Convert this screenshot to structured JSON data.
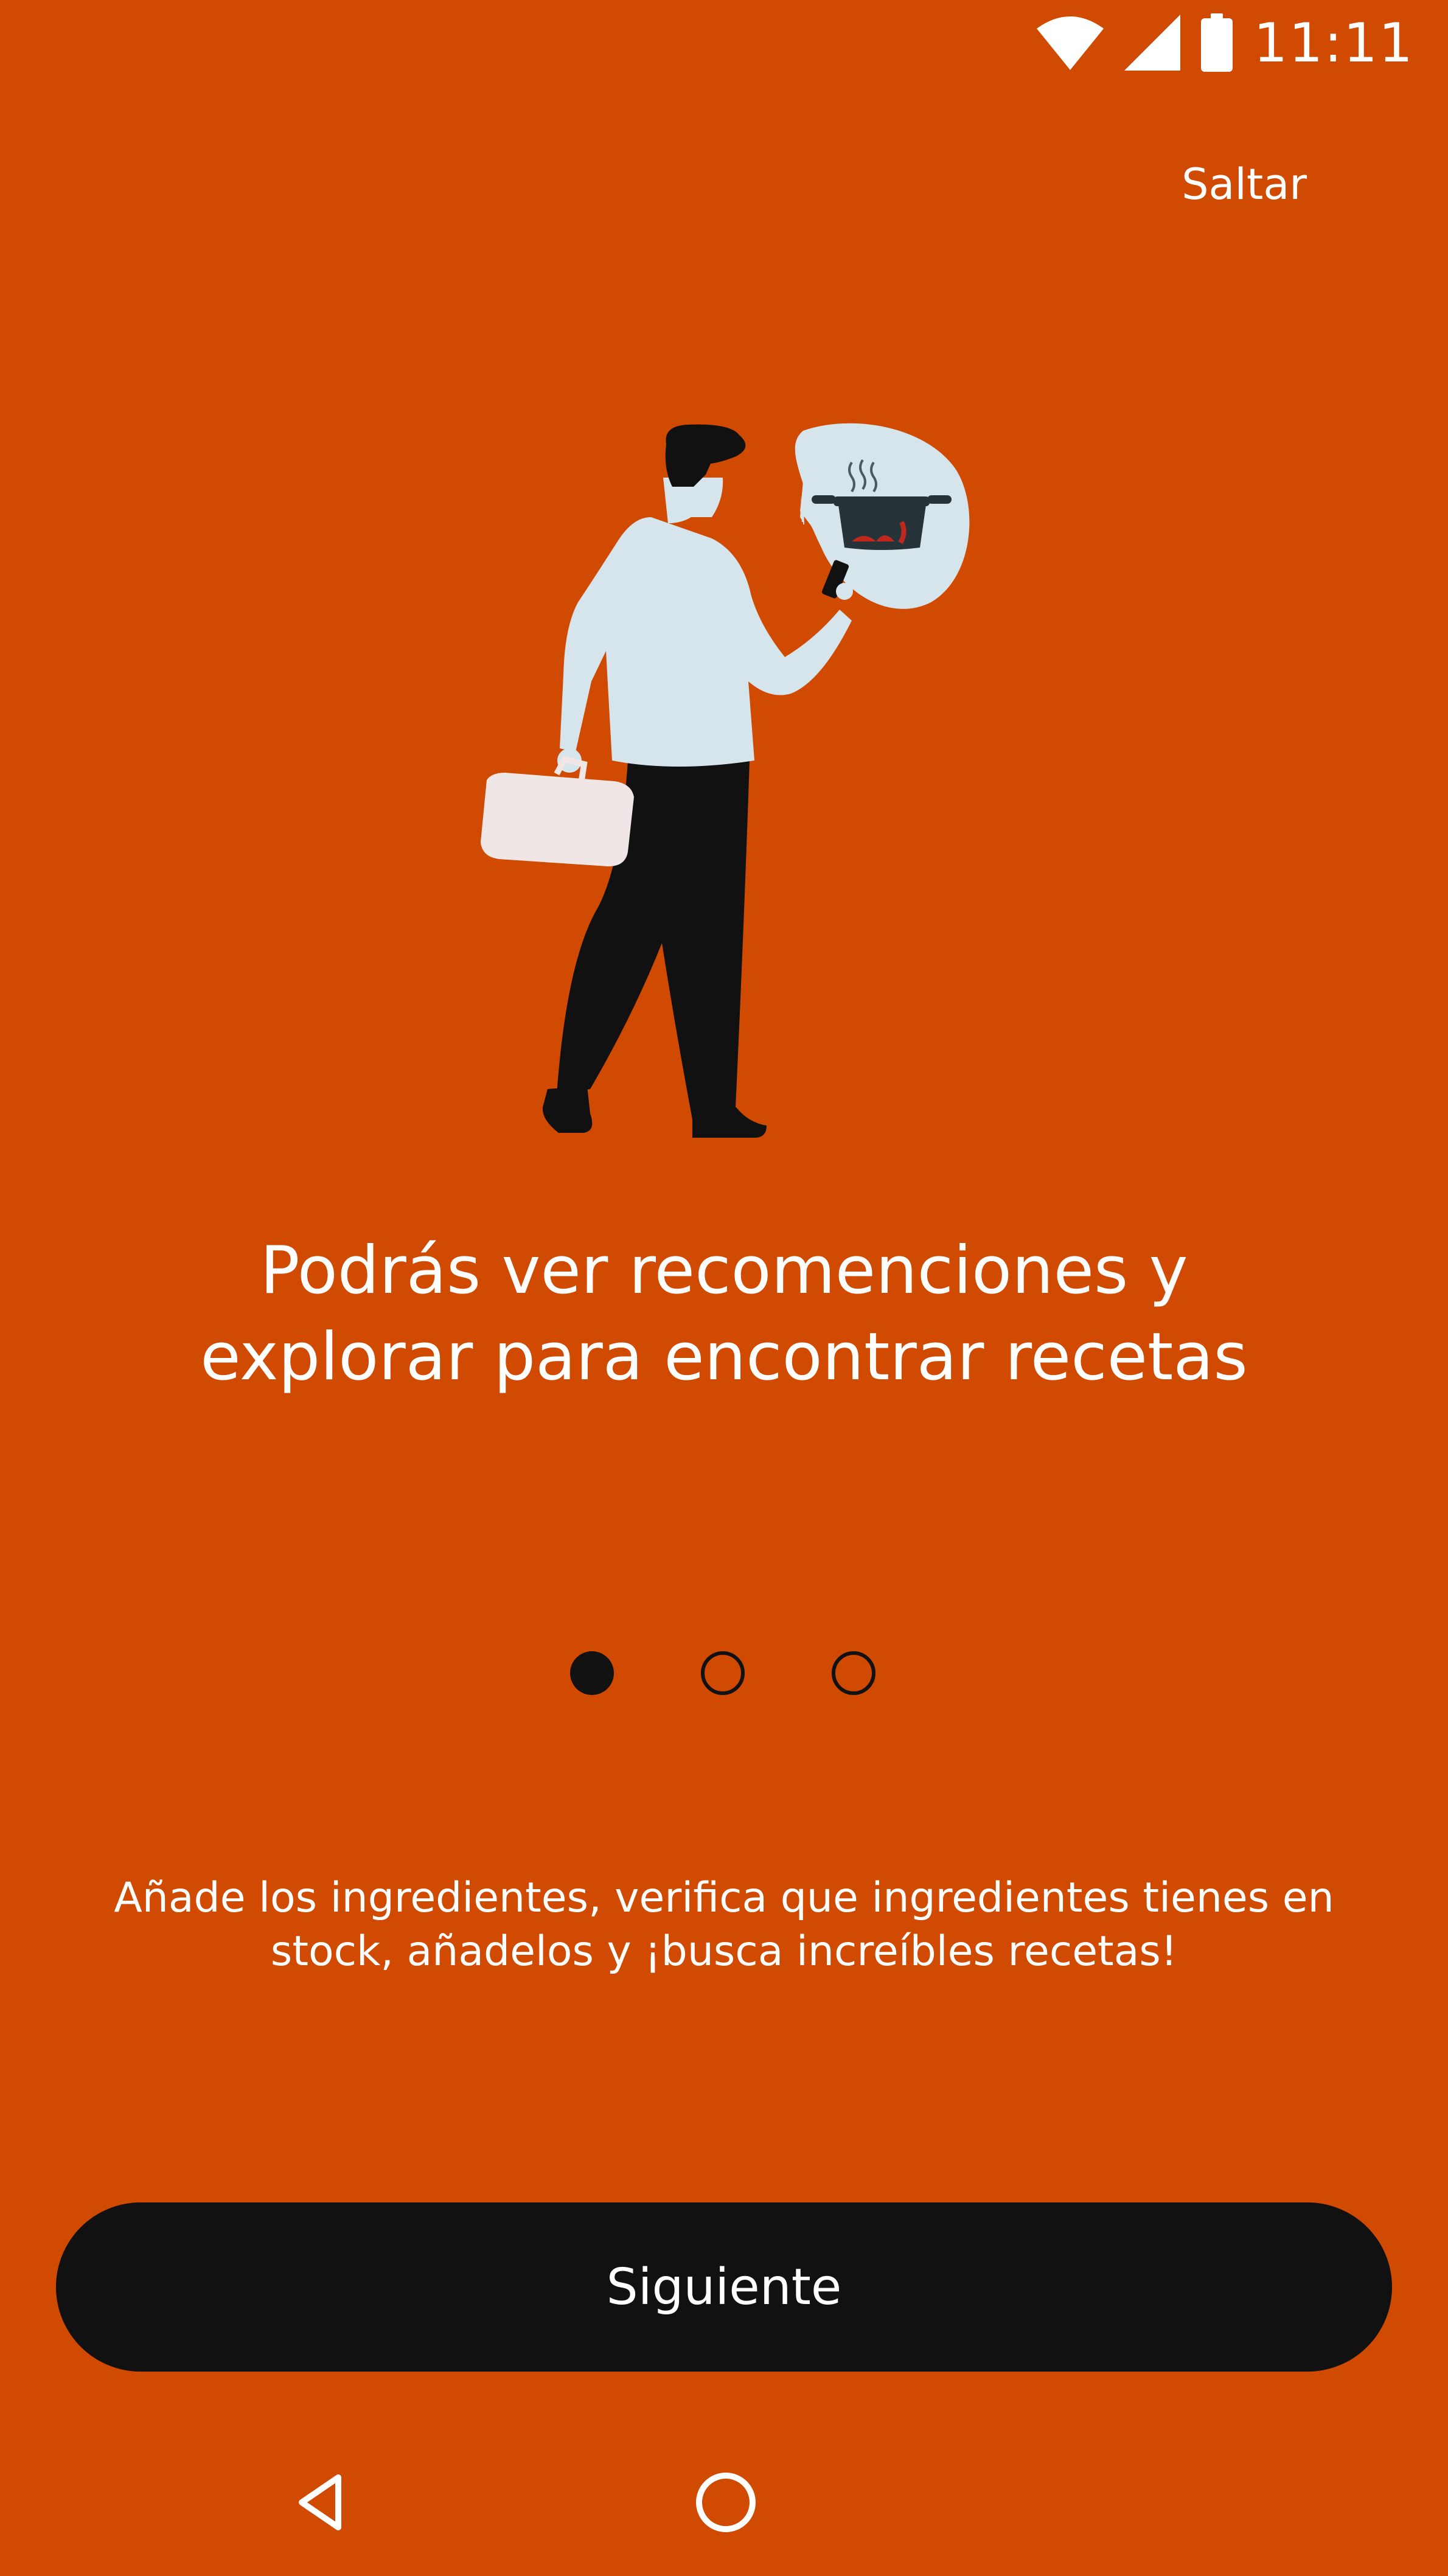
{
  "status_bar": {
    "time": "11:11",
    "icons": [
      "wifi-icon",
      "cell-signal-icon",
      "battery-icon"
    ]
  },
  "skip_label": "Saltar",
  "illustration": {
    "description_icons": [
      "person-with-phone",
      "briefcase",
      "speech-bubble",
      "cooking-pot"
    ]
  },
  "headline": "Podrás ver recomenciones y explorar para encontrar recetas",
  "pager": {
    "total": 3,
    "active_index": 0
  },
  "description": "Añade los ingredientes, verifica que ingredientes tienes en stock, añadelos y ¡busca increíbles recetas!",
  "next_button_label": "Siguiente",
  "nav_bar": {
    "icons": [
      "back-icon",
      "home-icon"
    ]
  },
  "colors": {
    "background": "#d04a02",
    "button": "#111111",
    "text": "#ffffff",
    "dot": "#121212"
  }
}
